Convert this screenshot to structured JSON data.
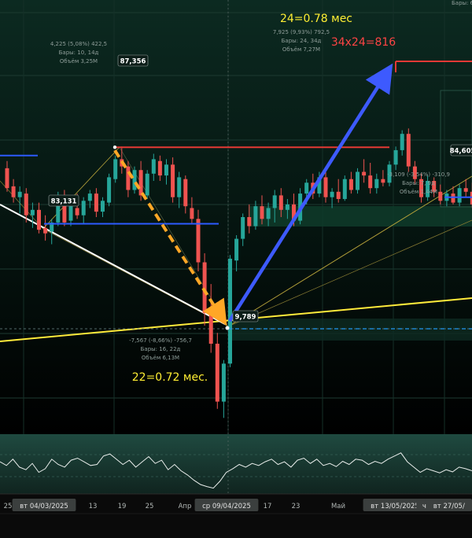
{
  "chart_data": {
    "type": "candlestick",
    "y_range": [
      71.5,
      95.5
    ],
    "x_axis": {
      "ticks": [
        "25",
        "вт 04/03/2025",
        "13",
        "19",
        "25",
        "Апр",
        "ср 09/04/2025",
        "17",
        "23",
        "Май",
        "7",
        "вт 13/05/2025",
        "чт 22/",
        "вт 27/05/"
      ],
      "highlighted": [
        "вт 04/03/2025",
        "ср 09/04/2025",
        "вт 13/05/2025",
        "чт 22/",
        "вт 27/05/"
      ]
    },
    "price_marks": {
      "low_start": "83,131",
      "peak_1": "87,356",
      "trough": "9,789",
      "right_mark": "84,605"
    },
    "levels": {
      "red_high_1": 87.36,
      "blue_level_1": 83.13,
      "blue_level_2": 84.6,
      "blue_left": 86.9
    },
    "measures": [
      {
        "lines": [
          "4,225 (5,08%) 422,5",
          "Бары: 10, 14д",
          "Объём 3,25M"
        ]
      },
      {
        "lines": [
          "7,925 (9,93%) 792,5",
          "Бары: 24, 34д",
          "Объём 7,27M"
        ]
      },
      {
        "lines": [
          "-7,567 (-8,66%) -756,7",
          "Бары: 16, 22д",
          "Объём 6,13M"
        ]
      },
      {
        "lines": [
          "-3,109 (-3,54%) -310,9",
          "Бары: 7, 9д",
          "Объём 1,44M"
        ]
      }
    ],
    "annotations": {
      "top": "24=0.78 мес",
      "top_red": "34x24=816",
      "bottom": "22=0.72 мес.",
      "corner": "Бары: 6"
    },
    "colors": {
      "up": "#26a69a",
      "down": "#ef5350",
      "red_line": "#e53935",
      "blue_line": "#2d5bff",
      "arrow_up": "#3d5afe",
      "arrow_down": "#ffa726",
      "yellow": "#ffeb3b",
      "yellow_text": "#ffee33",
      "red_text": "#ff4444"
    },
    "candles": [
      [
        86.2,
        86.6,
        84.9,
        85.1
      ],
      [
        85.2,
        85.6,
        84.3,
        84.6
      ],
      [
        84.6,
        85.2,
        83.7,
        84.9
      ],
      [
        84.8,
        85.1,
        83.2,
        83.6
      ],
      [
        83.6,
        84.3,
        82.9,
        83.9
      ],
      [
        83.9,
        84.3,
        82.6,
        82.8
      ],
      [
        82.9,
        83.6,
        82.2,
        82.6
      ],
      [
        82.7,
        83.4,
        82.0,
        83.2
      ],
      [
        83.2,
        84.9,
        83.0,
        84.7
      ],
      [
        84.6,
        85.0,
        83.0,
        83.2
      ],
      [
        83.3,
        84.3,
        83.0,
        84.1
      ],
      [
        84.0,
        84.8,
        83.4,
        83.6
      ],
      [
        83.6,
        84.6,
        83.1,
        84.4
      ],
      [
        84.4,
        85.0,
        84.0,
        84.8
      ],
      [
        84.8,
        85.1,
        83.5,
        83.8
      ],
      [
        83.8,
        84.6,
        83.5,
        84.4
      ],
      [
        84.3,
        85.9,
        84.1,
        85.7
      ],
      [
        85.6,
        86.9,
        85.4,
        86.7
      ],
      [
        86.7,
        87.4,
        85.9,
        86.3
      ],
      [
        86.3,
        86.6,
        84.6,
        85.0
      ],
      [
        85.0,
        86.3,
        84.8,
        86.1
      ],
      [
        86.1,
        86.6,
        84.4,
        84.7
      ],
      [
        84.7,
        86.1,
        84.5,
        85.9
      ],
      [
        85.9,
        87.0,
        85.5,
        86.7
      ],
      [
        86.6,
        86.9,
        85.5,
        85.8
      ],
      [
        85.8,
        86.7,
        85.3,
        86.4
      ],
      [
        86.4,
        86.8,
        84.3,
        84.6
      ],
      [
        84.6,
        86.0,
        84.0,
        85.7
      ],
      [
        85.6,
        85.8,
        83.7,
        84.1
      ],
      [
        84.0,
        84.6,
        83.1,
        83.4
      ],
      [
        83.4,
        83.9,
        80.5,
        81.0
      ],
      [
        81.0,
        81.5,
        77.5,
        78.2
      ],
      [
        78.2,
        79.8,
        76.0,
        76.5
      ],
      [
        76.5,
        77.1,
        72.9,
        73.3
      ],
      [
        73.3,
        75.6,
        72.4,
        75.4
      ],
      [
        75.4,
        81.4,
        75.2,
        81.2
      ],
      [
        81.1,
        82.5,
        80.5,
        82.3
      ],
      [
        82.3,
        83.7,
        81.9,
        83.5
      ],
      [
        83.5,
        84.2,
        82.6,
        83.0
      ],
      [
        83.0,
        84.4,
        82.8,
        84.1
      ],
      [
        84.1,
        84.7,
        83.1,
        83.4
      ],
      [
        83.4,
        84.3,
        83.0,
        84.0
      ],
      [
        84.0,
        85.0,
        83.2,
        84.7
      ],
      [
        84.7,
        85.1,
        83.5,
        83.9
      ],
      [
        83.9,
        84.5,
        83.4,
        84.2
      ],
      [
        84.2,
        84.8,
        83.0,
        83.3
      ],
      [
        83.3,
        85.1,
        83.1,
        84.8
      ],
      [
        84.8,
        85.6,
        84.2,
        85.4
      ],
      [
        85.4,
        85.9,
        84.5,
        84.8
      ],
      [
        84.8,
        86.0,
        84.6,
        85.7
      ],
      [
        85.7,
        86.0,
        84.3,
        84.6
      ],
      [
        84.6,
        85.1,
        84.0,
        84.9
      ],
      [
        84.9,
        85.6,
        84.3,
        84.5
      ],
      [
        84.5,
        85.8,
        84.4,
        85.6
      ],
      [
        85.6,
        86.0,
        84.8,
        85.0
      ],
      [
        85.0,
        86.2,
        84.8,
        86.0
      ],
      [
        86.0,
        86.7,
        85.4,
        85.8
      ],
      [
        85.8,
        86.5,
        84.8,
        85.1
      ],
      [
        85.1,
        85.9,
        84.8,
        85.6
      ],
      [
        85.6,
        86.1,
        85.2,
        85.4
      ],
      [
        85.4,
        86.6,
        85.2,
        86.4
      ],
      [
        86.4,
        87.4,
        86.1,
        87.2
      ],
      [
        87.2,
        88.3,
        86.9,
        88.1
      ],
      [
        88.1,
        88.4,
        86.0,
        86.3
      ],
      [
        86.3,
        86.6,
        85.3,
        85.6
      ],
      [
        85.6,
        85.9,
        84.3,
        84.6
      ],
      [
        84.6,
        85.8,
        84.4,
        85.5
      ],
      [
        85.5,
        85.7,
        84.6,
        84.9
      ],
      [
        84.9,
        85.3,
        84.2,
        84.4
      ],
      [
        84.4,
        85.0,
        84.1,
        84.8
      ],
      [
        84.8,
        85.2,
        84.2,
        84.3
      ],
      [
        84.3,
        85.3,
        84.1,
        85.1
      ],
      [
        85.1,
        85.6,
        84.6,
        84.9
      ],
      [
        84.9,
        85.4,
        84.0,
        84.2
      ]
    ],
    "oscillator": [
      0.55,
      0.48,
      0.6,
      0.45,
      0.4,
      0.52,
      0.35,
      0.42,
      0.6,
      0.5,
      0.45,
      0.58,
      0.62,
      0.55,
      0.48,
      0.5,
      0.66,
      0.7,
      0.6,
      0.5,
      0.58,
      0.45,
      0.55,
      0.65,
      0.52,
      0.58,
      0.4,
      0.5,
      0.38,
      0.3,
      0.2,
      0.12,
      0.08,
      0.05,
      0.18,
      0.35,
      0.42,
      0.5,
      0.45,
      0.52,
      0.48,
      0.55,
      0.6,
      0.5,
      0.55,
      0.45,
      0.58,
      0.62,
      0.52,
      0.6,
      0.48,
      0.52,
      0.46,
      0.56,
      0.5,
      0.6,
      0.58,
      0.5,
      0.56,
      0.52,
      0.6,
      0.66,
      0.72,
      0.55,
      0.45,
      0.35,
      0.42,
      0.38,
      0.34,
      0.4,
      0.36,
      0.45,
      0.42,
      0.38
    ]
  }
}
